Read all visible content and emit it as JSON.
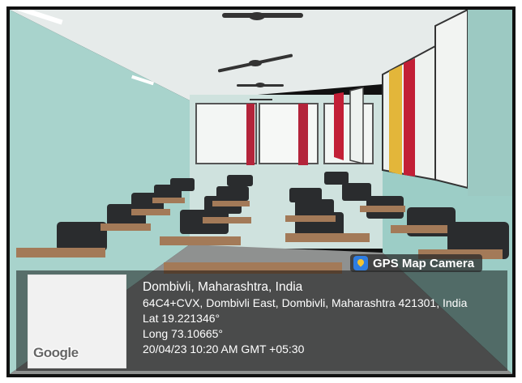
{
  "brand": {
    "label": "GPS Map Camera",
    "icon": "gps-camera-icon"
  },
  "map": {
    "logo_text": "Google"
  },
  "location": {
    "city": "Dombivli, Maharashtra, India",
    "address": "64C4+CVX, Dombivli East, Dombivli, Maharashtra 421301, India",
    "lat": "Lat 19.221346°",
    "long": "Long 73.10665°",
    "timestamp": "20/04/23 10:20 AM GMT +05:30"
  },
  "colors": {
    "wall": "#9fcfc8",
    "ceiling": "#e9eeee",
    "curtain_red": "#c21f36",
    "curtain_yellow": "#e3b63a"
  }
}
